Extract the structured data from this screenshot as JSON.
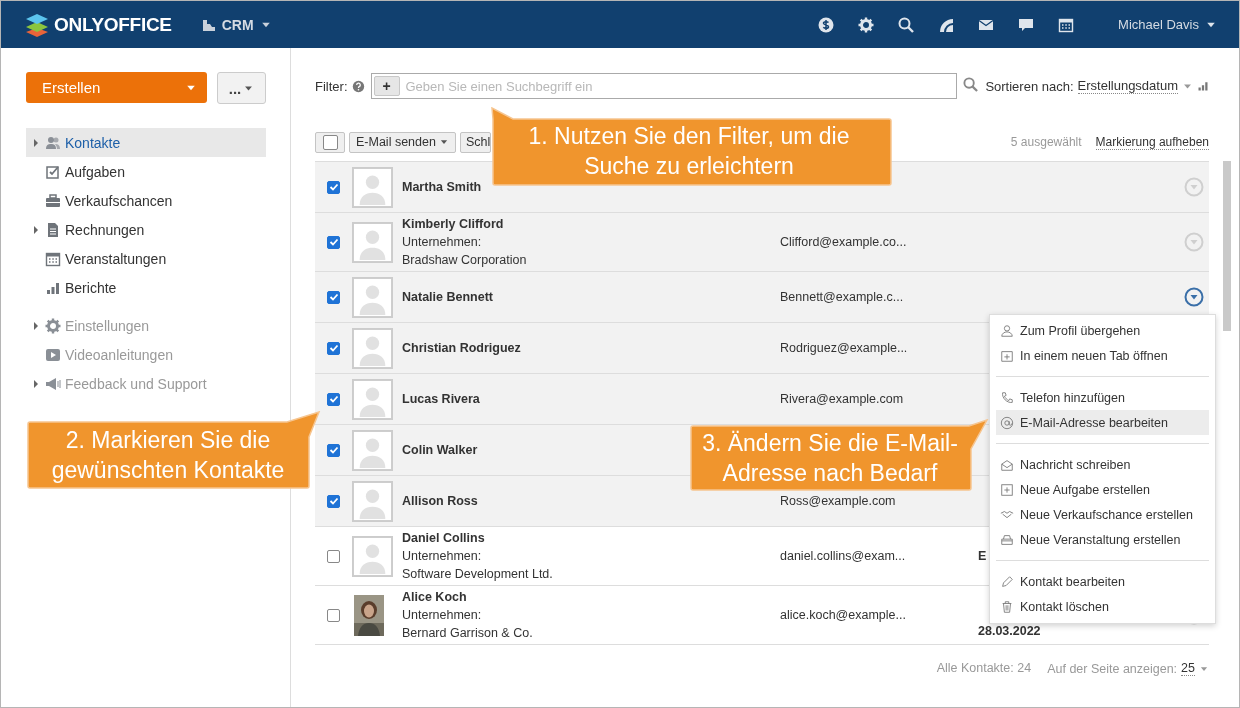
{
  "header": {
    "logo": "ONLYOFFICE",
    "module": "CRM",
    "user": "Michael Davis"
  },
  "sidebar": {
    "create_button": "Erstellen",
    "more_button": "...",
    "items": [
      {
        "label": "Kontakte",
        "selected": true,
        "expandable": true
      },
      {
        "label": "Aufgaben",
        "selected": false,
        "expandable": false
      },
      {
        "label": "Verkaufschancen",
        "selected": false,
        "expandable": false
      },
      {
        "label": "Rechnungen",
        "selected": false,
        "expandable": true
      },
      {
        "label": "Veranstaltungen",
        "selected": false,
        "expandable": false
      },
      {
        "label": "Berichte",
        "selected": false,
        "expandable": false
      }
    ],
    "secondary_items": [
      {
        "label": "Einstellungen",
        "expandable": true
      },
      {
        "label": "Videoanleitungen",
        "expandable": false
      },
      {
        "label": "Feedback und Support",
        "expandable": true
      }
    ]
  },
  "filter": {
    "label": "Filter:",
    "add": "+",
    "placeholder": "Geben Sie einen Suchbegriff ein",
    "sort_label": "Sortieren nach:",
    "sort_value": "Erstellungsdatum"
  },
  "toolbar": {
    "select_all_checked": false,
    "buttons": [
      {
        "label": "E-Mail senden",
        "dropdown": true
      },
      {
        "label": "Schl",
        "dropdown": false
      }
    ],
    "selected_count": "5 ausgewählt",
    "clear": "Markierung aufheben"
  },
  "rows": [
    {
      "name": "Martha Smith",
      "checked": true,
      "photo": false,
      "menu_open": false
    },
    {
      "name": "Kimberly Clifford",
      "company_label": "Unternehmen:",
      "company": "Bradshaw Corporation",
      "email": "Clifford@example.co...",
      "checked": true,
      "photo": false,
      "menu_open": false
    },
    {
      "name": "Natalie Bennett",
      "email": "Bennett@example.c...",
      "checked": true,
      "photo": false,
      "menu_open": true
    },
    {
      "name": "Christian Rodriguez",
      "email": "Rodriguez@example...",
      "checked": true,
      "photo": false
    },
    {
      "name": "Lucas Rivera",
      "email": "Rivera@example.com",
      "checked": true,
      "photo": false
    },
    {
      "name": "Colin Walker",
      "checked": true,
      "photo": false
    },
    {
      "name": "Allison Ross",
      "email": "Ross@example.com",
      "checked": true,
      "photo": false
    },
    {
      "name": "Daniel Collins",
      "company_label": "Unternehmen:",
      "company": "Software Development Ltd.",
      "email": "daniel.collins@exam...",
      "column_4": "E",
      "checked": false,
      "photo": false
    },
    {
      "name": "Alice Koch",
      "company_label": "Unternehmen:",
      "company": "Bernard Garrison & Co.",
      "email": "alice.koch@example...",
      "column_4": "28.03.2022",
      "checked": false,
      "photo": true,
      "menu_open": false
    }
  ],
  "context_menu": [
    [
      {
        "label": "Zum Profil übergehen",
        "selected": false
      },
      {
        "label": "In einem neuen Tab öffnen",
        "selected": false
      }
    ],
    [
      {
        "label": "Telefon hinzufügen",
        "selected": false
      },
      {
        "label": "E-Mail-Adresse bearbeiten",
        "selected": true
      }
    ],
    [
      {
        "label": "Nachricht schreiben",
        "selected": false
      },
      {
        "label": "Neue Aufgabe erstellen",
        "selected": false
      },
      {
        "label": "Neue Verkaufschance erstellen",
        "selected": false
      },
      {
        "label": "Neue Veranstaltung erstellen",
        "selected": false
      }
    ],
    [
      {
        "label": "Kontakt bearbeiten",
        "selected": false
      },
      {
        "label": "Kontakt löschen",
        "selected": false
      }
    ]
  ],
  "footer": {
    "total": "Alle Kontakte: 24",
    "per_page_label": "Auf der Seite anzeigen:",
    "per_page": "25"
  },
  "callouts": [
    "1. Nutzen Sie den Filter, um die Suche zu erleichtern",
    "2. Markieren Sie die gewünschten Kontakte",
    "3. Ändern Sie die E-Mail-Adresse nach Bedarf"
  ]
}
